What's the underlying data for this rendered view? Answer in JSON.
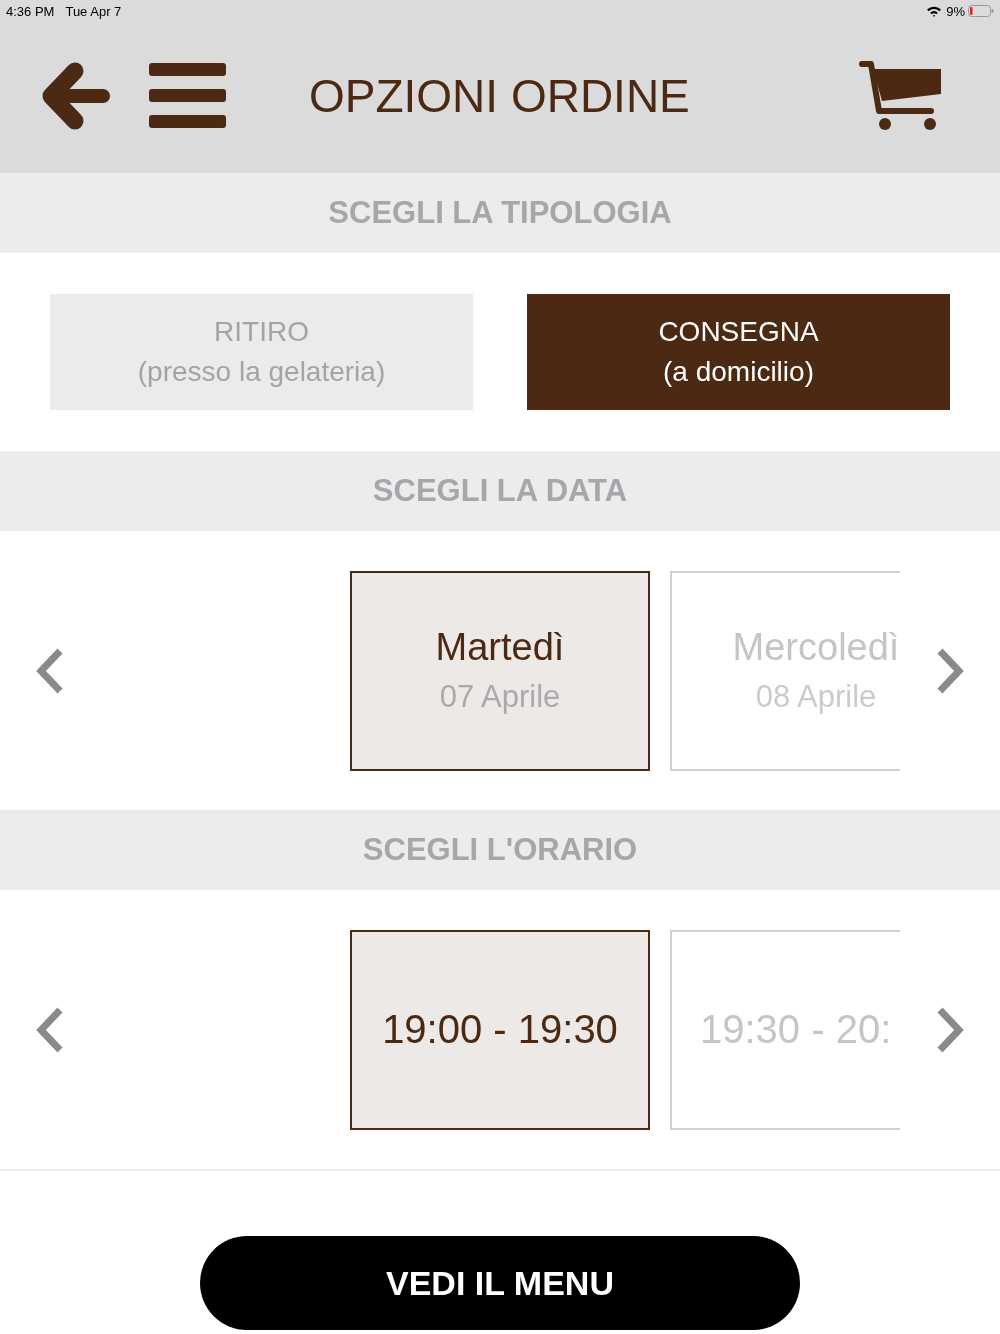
{
  "status_bar": {
    "time": "4:36 PM",
    "date": "Tue Apr 7",
    "battery": "9%"
  },
  "header": {
    "title": "OPZIONI ORDINE"
  },
  "sections": [
    {
      "kind": "options",
      "heading": "SCEGLI LA TIPOLOGIA",
      "options": [
        {
          "label": "RITIRO",
          "sublabel": "(presso la gelateria)",
          "selected": false
        },
        {
          "label": "CONSEGNA",
          "sublabel": "(a domicilio)",
          "selected": true
        }
      ]
    },
    {
      "kind": "dates",
      "heading": "SCEGLI LA DATA",
      "cards": [
        {
          "title": "Martedì",
          "subtitle": "07 Aprile",
          "selected": true
        },
        {
          "title": "Mercoledì",
          "subtitle": "08 Aprile",
          "selected": false
        }
      ]
    },
    {
      "kind": "times",
      "heading": "SCEGLI L'ORARIO",
      "cards": [
        {
          "title": "19:00 - 19:30",
          "selected": true
        },
        {
          "title": "19:30 - 20:",
          "selected": false
        }
      ]
    }
  ],
  "footer": {
    "button": "VEDI IL MENU"
  }
}
